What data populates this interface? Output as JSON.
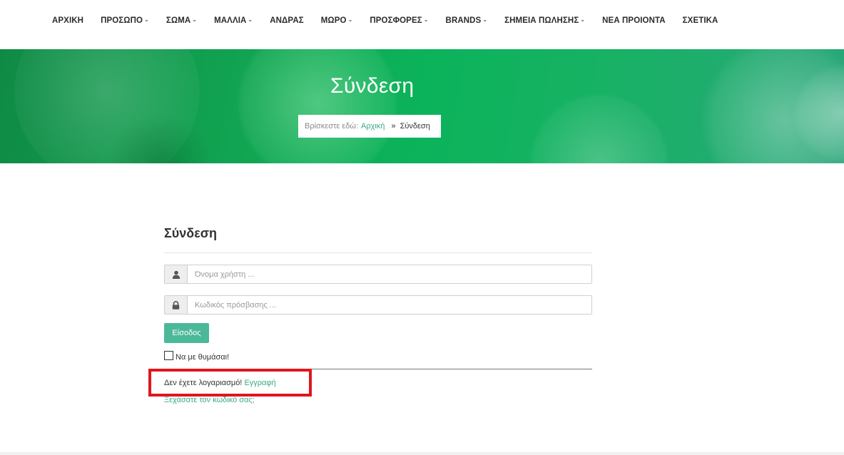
{
  "nav": {
    "items": [
      {
        "label": "ΑΡΧΙΚΗ",
        "has_dropdown": false
      },
      {
        "label": "ΠΡΟΣΩΠΟ",
        "has_dropdown": true
      },
      {
        "label": "ΣΩΜΑ",
        "has_dropdown": true
      },
      {
        "label": "ΜΑΛΛΙΑ",
        "has_dropdown": true
      },
      {
        "label": "ΑΝΔΡΑΣ",
        "has_dropdown": false
      },
      {
        "label": "ΜΩΡΟ",
        "has_dropdown": true
      },
      {
        "label": "ΠΡΟΣΦΟΡΕΣ",
        "has_dropdown": true
      },
      {
        "label": "BRANDS",
        "has_dropdown": true
      },
      {
        "label": "ΣΗΜΕΙΑ ΠΩΛΗΣΗΣ",
        "has_dropdown": true
      },
      {
        "label": "ΝΕΑ ΠΡΟΙΟΝΤΑ",
        "has_dropdown": false
      },
      {
        "label": "ΣΧΕΤΙΚΑ",
        "has_dropdown": false
      }
    ]
  },
  "hero": {
    "title": "Σύνδεση",
    "breadcrumb": {
      "prefix": "Βρίσκεστε εδώ:",
      "home": "Αρχική",
      "separator": "»",
      "current": "Σύνδεση"
    }
  },
  "login": {
    "title": "Σύνδεση",
    "username": {
      "placeholder": "Όνομα χρήστη ...",
      "value": "",
      "icon": "user-icon"
    },
    "password": {
      "placeholder": "Κωδικός πρόσβασης ...",
      "value": "",
      "icon": "lock-icon"
    },
    "submit_label": "Είσοδος",
    "remember_label": "Να με θυμάσαι!",
    "remember_checked": false,
    "no_account_text": "Δεν έχετε λογαριασμό!",
    "register_link": "Εγγραφή",
    "forgot_link": "Ξεχάσατε τον κωδικό σας;"
  },
  "colors": {
    "accent": "#4cb89a",
    "link": "#3aa981",
    "highlight_box": "#e0161e",
    "hero_green": "#0bb35a"
  }
}
